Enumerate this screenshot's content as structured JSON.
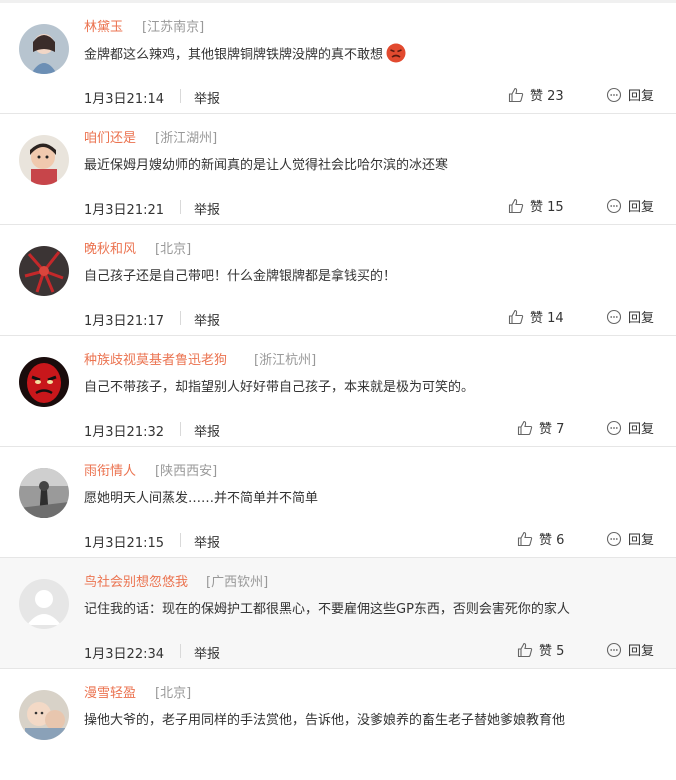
{
  "actions": {
    "report_label": "举报",
    "reply_label": "回复",
    "like_prefix": "赞"
  },
  "comments": [
    {
      "user": "林黛玉",
      "location": "[江苏南京]",
      "text": "金牌都这么辣鸡，其他银牌铜牌铁牌没牌的真不敢想",
      "time": "1月3日21:14",
      "likes": "23"
    },
    {
      "user": "咱们还是",
      "location": "[浙江湖州]",
      "text": "最近保姆月嫂幼师的新闻真的是让人觉得社会比哈尔滨的冰还寒",
      "time": "1月3日21:21",
      "likes": "15"
    },
    {
      "user": "晚秋和风",
      "location": "[北京]",
      "text": "自己孩子还是自己带吧！什么金牌银牌都是拿钱买的！",
      "time": "1月3日21:17",
      "likes": "14"
    },
    {
      "user": "种族歧视莫基者鲁迅老狗",
      "location": "[浙江杭州]",
      "text": "自己不带孩子，却指望别人好好带自己孩子，本来就是极为可笑的。",
      "time": "1月3日21:32",
      "likes": "7"
    },
    {
      "user": "雨衔情人",
      "location": "[陕西西安]",
      "text": "愿她明天人间蒸发……并不简单并不简单",
      "time": "1月3日21:15",
      "likes": "6"
    },
    {
      "user": "鸟社会别想忽悠我",
      "location": "[广西钦州]",
      "text": "记住我的话：现在的保姆护工都很黑心，不要雇佣这些GP东西，否则会害死你的家人",
      "time": "1月3日22:34",
      "likes": "5"
    },
    {
      "user": "漫雪轻盈",
      "location": "[北京]",
      "text": "操他大爷的，老子用同样的手法赏他，告诉他，没爹娘养的畜生老子替她爹娘教育他",
      "time": "",
      "likes": ""
    }
  ]
}
